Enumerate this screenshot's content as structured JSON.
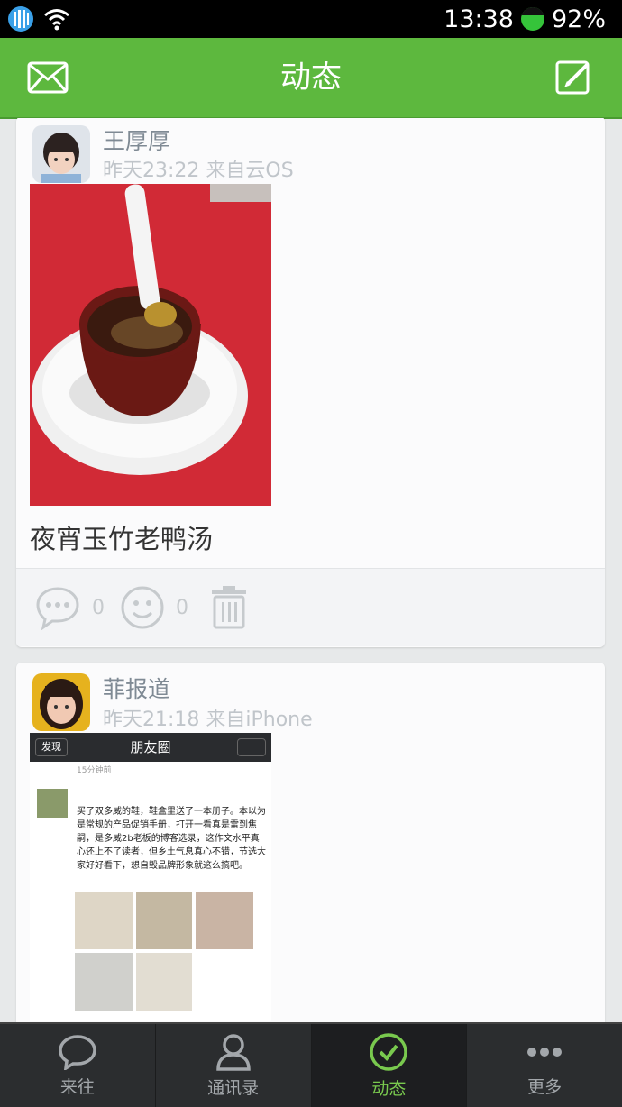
{
  "status_bar": {
    "time": "13:38",
    "battery": "92%"
  },
  "title_bar": {
    "title": "动态"
  },
  "posts": [
    {
      "author": "王厚厚",
      "meta": "昨天23:22 来自云OS",
      "caption": "夜宵玉竹老鸭汤",
      "comment_count": "0",
      "like_count": "0"
    },
    {
      "author": "菲报道",
      "meta": "昨天21:18 来自iPhone",
      "screenshot": {
        "back_label": "发现",
        "title": "朋友圈",
        "time_ago": "15分钟前",
        "text": "买了双多威的鞋，鞋盒里送了一本册子。本以为是常规的产品促销手册，打开一看真是雷到焦嗣，是多威2b老板的博客选录，这作文水平真心还上不了读者，但乡土气息真心不错，节选大家好好看下，想自毁品牌形象就这么搞吧。"
      }
    }
  ],
  "bottom_nav": [
    {
      "label": "来往",
      "icon": "chat-bubble-icon"
    },
    {
      "label": "通讯录",
      "icon": "contacts-icon"
    },
    {
      "label": "动态",
      "icon": "check-circle-icon"
    },
    {
      "label": "更多",
      "icon": "more-dots-icon"
    }
  ],
  "colors": {
    "accent": "#5db83e",
    "nav_active": "#79c94e"
  }
}
